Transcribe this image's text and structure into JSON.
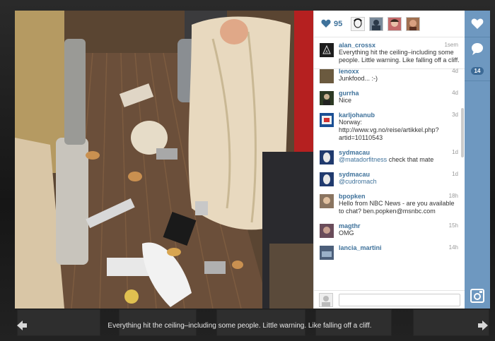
{
  "likes": {
    "count": "95"
  },
  "comments": [
    {
      "user": "alan_crossx",
      "text": "Everything hit the ceiling–including some people. Little warning. Like falling off a cliff.",
      "time": "1sem",
      "avatar_color": "#1e1e1e"
    },
    {
      "user": "lenoxx",
      "text": "Junkfood... :-)",
      "time": "4d",
      "avatar_color": "#6b5a3f"
    },
    {
      "user": "gurrha",
      "text": "Nice",
      "time": "4d",
      "avatar_color": "#2d3a24"
    },
    {
      "user": "karljohanub",
      "text": "Norway: http://www.vg.no/reise/artikkel.php?artid=10110543",
      "time": "3d",
      "avatar_color": "#1a4f94"
    },
    {
      "user": "sydmacau",
      "mention": "@matadorfitness",
      "text": "check that mate",
      "time": "1d",
      "avatar_color": "#203a6e"
    },
    {
      "user": "sydmacau",
      "mention": "@cudromach",
      "text": "",
      "time": "1d",
      "avatar_color": "#203a6e"
    },
    {
      "user": "bpopken",
      "text": "Hello from NBC News - are you available to chat? ben.popken@msnbc.com",
      "time": "18h",
      "avatar_color": "#8a7460"
    },
    {
      "user": "magthr",
      "text": "OMG",
      "time": "15h",
      "avatar_color": "#6a4c5a"
    },
    {
      "user": "lancia_martini",
      "text": "",
      "time": "14h",
      "avatar_color": "#4c5f7a"
    }
  ],
  "comment_box": {
    "placeholder": ""
  },
  "actions": {
    "comment_count": "14"
  },
  "caption": "Everything hit the ceiling–including some people. Little warning. Like falling off a cliff.",
  "colors": {
    "accent": "#3f729b",
    "sidebar": "#6e98c0"
  },
  "icons": [
    "heart-icon",
    "comment-icon",
    "instagram-icon",
    "arrow-left-icon",
    "arrow-right-icon"
  ]
}
